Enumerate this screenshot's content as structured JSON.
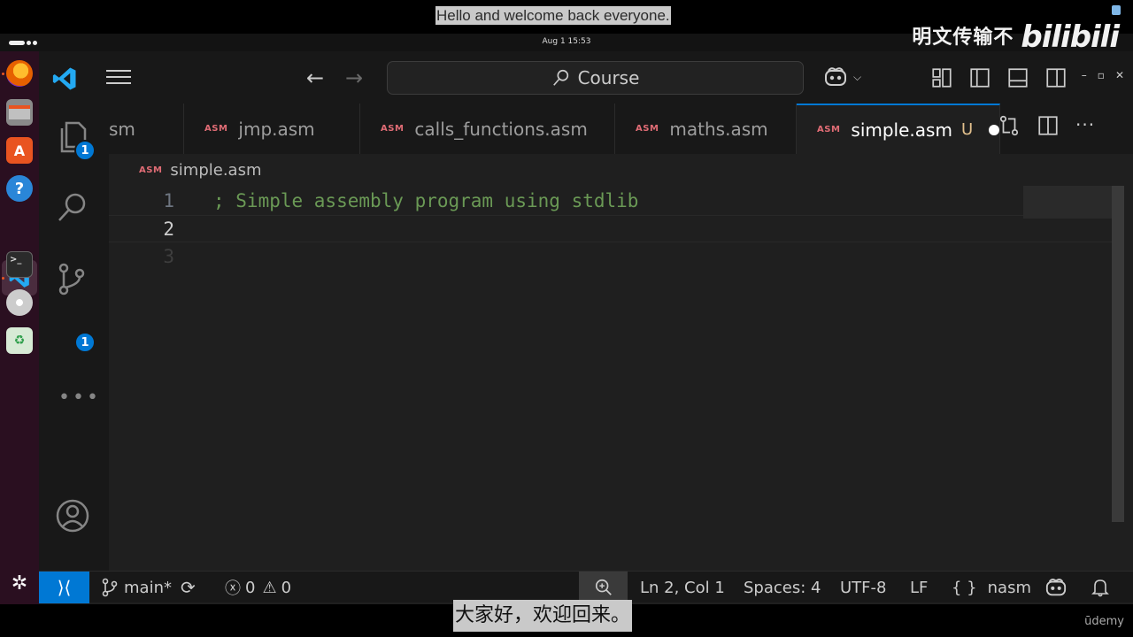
{
  "video": {
    "caption_en": "Hello and welcome back everyone.",
    "caption_zh": "大家好，欢迎回来。",
    "watermark_text": "明文传输不",
    "watermark_logo": "bilibili",
    "udemy_label": "ūdemy"
  },
  "system": {
    "clock": "Aug 1  15:53"
  },
  "dock": {
    "items": [
      "firefox-icon",
      "files-icon",
      "app-center-icon",
      "help-icon",
      "vscode-icon",
      "terminal-icon",
      "disc-icon",
      "trash-icon",
      "ubuntu-logo-icon"
    ]
  },
  "titlebar": {
    "search_label": "Course"
  },
  "activity": {
    "explorer_badge": "1",
    "source_control_badge": "1"
  },
  "tabs": [
    {
      "label": "sm",
      "icon": "asm"
    },
    {
      "label": "jmp.asm",
      "icon": "ASM"
    },
    {
      "label": "calls_functions.asm",
      "icon": "ASM"
    },
    {
      "label": "maths.asm",
      "icon": "ASM"
    },
    {
      "label": "simple.asm",
      "icon": "ASM",
      "modified_flag": "U",
      "active": true
    }
  ],
  "breadcrumb": {
    "icon": "ASM",
    "file": "simple.asm"
  },
  "editor": {
    "lines": [
      {
        "number": "1",
        "text": "; Simple assembly program using stdlib"
      },
      {
        "number": "2",
        "text": ""
      },
      {
        "number": "3",
        "text": ""
      }
    ],
    "current_line": 2
  },
  "statusbar": {
    "branch": "main*",
    "errors": "0",
    "warnings": "0",
    "position": "Ln 2, Col 1",
    "spaces": "Spaces: 4",
    "encoding": "UTF-8",
    "eol": "LF",
    "language": "nasm",
    "language_icon": "{ }"
  },
  "colors": {
    "accent": "#0078d4",
    "comment": "#6a9955",
    "asm_icon": "#e06c75",
    "modified": "#e2c08d"
  }
}
